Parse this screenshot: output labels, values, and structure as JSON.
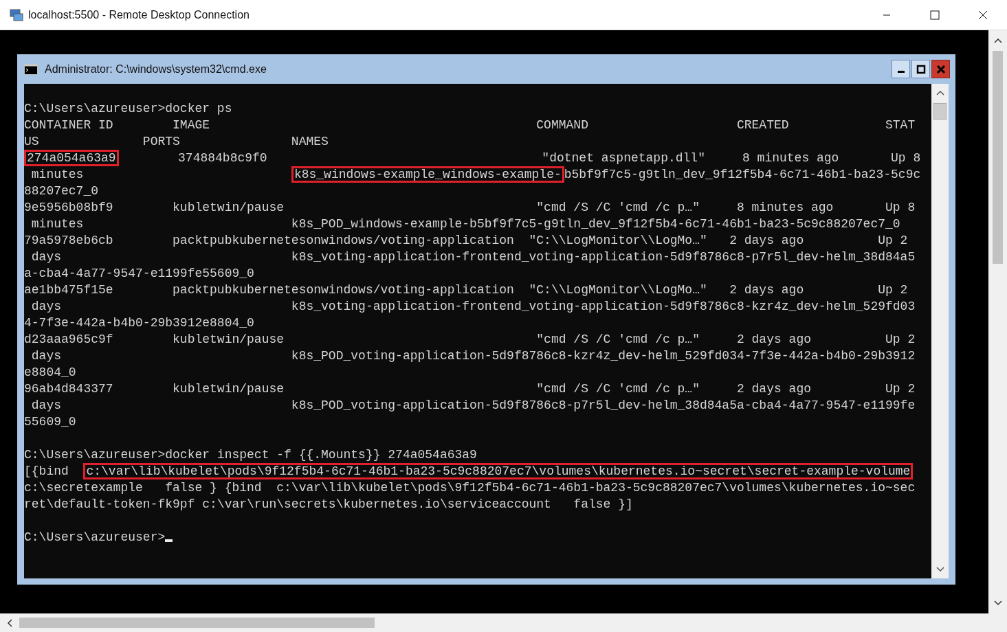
{
  "window": {
    "title": "localhost:5500 - Remote Desktop Connection"
  },
  "console_window": {
    "title": "Administrator: C:\\windows\\system32\\cmd.exe",
    "blocks": [
      {
        "lines": [
          [
            {
              "text": "C:\\Users\\azureuser>docker ps",
              "highlighted": false
            }
          ],
          [
            {
              "text": "CONTAINER ID        IMAGE                                            COMMAND                    CREATED             STAT",
              "highlighted": false
            }
          ],
          [
            {
              "text": "US              PORTS               NAMES",
              "highlighted": false
            }
          ],
          [
            {
              "text": "274a054a63a9",
              "highlighted": true
            },
            {
              "text": "        374884b8c9f0                                     \"dotnet aspnetapp.dll\"     8 minutes ago       Up 8",
              "highlighted": false
            }
          ],
          [
            {
              "text": " minutes                            ",
              "highlighted": false
            },
            {
              "text": "k8s_windows-example_windows-example-",
              "highlighted": true
            },
            {
              "text": "b5bf9f7c5-g9tln_dev_9f12f5b4-6c71-46b1-ba23-5c9c",
              "highlighted": false
            }
          ],
          [
            {
              "text": "88207ec7_0",
              "highlighted": false
            }
          ],
          [
            {
              "text": "9e5956b08bf9        kubletwin/pause                                  \"cmd /S /C 'cmd /c p…\"     8 minutes ago       Up 8",
              "highlighted": false
            }
          ],
          [
            {
              "text": " minutes                            k8s_POD_windows-example-b5bf9f7c5-g9tln_dev_9f12f5b4-6c71-46b1-ba23-5c9c88207ec7_0",
              "highlighted": false
            }
          ],
          [
            {
              "text": "79a5978eb6cb        packtpubkubernetesonwindows/voting-application  \"C:\\\\LogMonitor\\\\LogMo…\"   2 days ago          Up 2",
              "highlighted": false
            }
          ],
          [
            {
              "text": " days                               k8s_voting-application-frontend_voting-application-5d9f8786c8-p7r5l_dev-helm_38d84a5",
              "highlighted": false
            }
          ],
          [
            {
              "text": "a-cba4-4a77-9547-e1199fe55609_0",
              "highlighted": false
            }
          ],
          [
            {
              "text": "ae1bb475f15e        packtpubkubernetesonwindows/voting-application  \"C:\\\\LogMonitor\\\\LogMo…\"   2 days ago          Up 2",
              "highlighted": false
            }
          ],
          [
            {
              "text": " days                               k8s_voting-application-frontend_voting-application-5d9f8786c8-kzr4z_dev-helm_529fd03",
              "highlighted": false
            }
          ],
          [
            {
              "text": "4-7f3e-442a-b4b0-29b3912e8804_0",
              "highlighted": false
            }
          ],
          [
            {
              "text": "d23aaa965c9f        kubletwin/pause                                  \"cmd /S /C 'cmd /c p…\"     2 days ago          Up 2",
              "highlighted": false
            }
          ],
          [
            {
              "text": " days                               k8s_POD_voting-application-5d9f8786c8-kzr4z_dev-helm_529fd034-7f3e-442a-b4b0-29b3912",
              "highlighted": false
            }
          ],
          [
            {
              "text": "e8804_0",
              "highlighted": false
            }
          ],
          [
            {
              "text": "96ab4d843377        kubletwin/pause                                  \"cmd /S /C 'cmd /c p…\"     2 days ago          Up 2",
              "highlighted": false
            }
          ],
          [
            {
              "text": " days                               k8s_POD_voting-application-5d9f8786c8-p7r5l_dev-helm_38d84a5a-cba4-4a77-9547-e1199fe",
              "highlighted": false
            }
          ],
          [
            {
              "text": "55609_0",
              "highlighted": false
            }
          ]
        ]
      },
      {
        "lines": [
          [
            {
              "text": "C:\\Users\\azureuser>docker inspect -f {{.Mounts}} 274a054a63a9",
              "highlighted": false
            }
          ],
          [
            {
              "text": "[{bind  ",
              "highlighted": false
            },
            {
              "text": "c:\\var\\lib\\kubelet\\pods\\9f12f5b4-6c71-46b1-ba23-5c9c88207ec7\\volumes\\kubernetes.io~secret\\secret-example-volume",
              "highlighted": true
            }
          ],
          [
            {
              "text": "c:\\secretexample   false } {bind  c:\\var\\lib\\kubelet\\pods\\9f12f5b4-6c71-46b1-ba23-5c9c88207ec7\\volumes\\kubernetes.io~sec",
              "highlighted": false
            }
          ],
          [
            {
              "text": "ret\\default-token-fk9pf c:\\var\\run\\secrets\\kubernetes.io\\serviceaccount   false }]",
              "highlighted": false
            }
          ]
        ]
      },
      {
        "lines": [
          [
            {
              "text": "C:\\Users\\azureuser>",
              "highlighted": false
            }
          ]
        ],
        "cursor": true
      }
    ]
  }
}
